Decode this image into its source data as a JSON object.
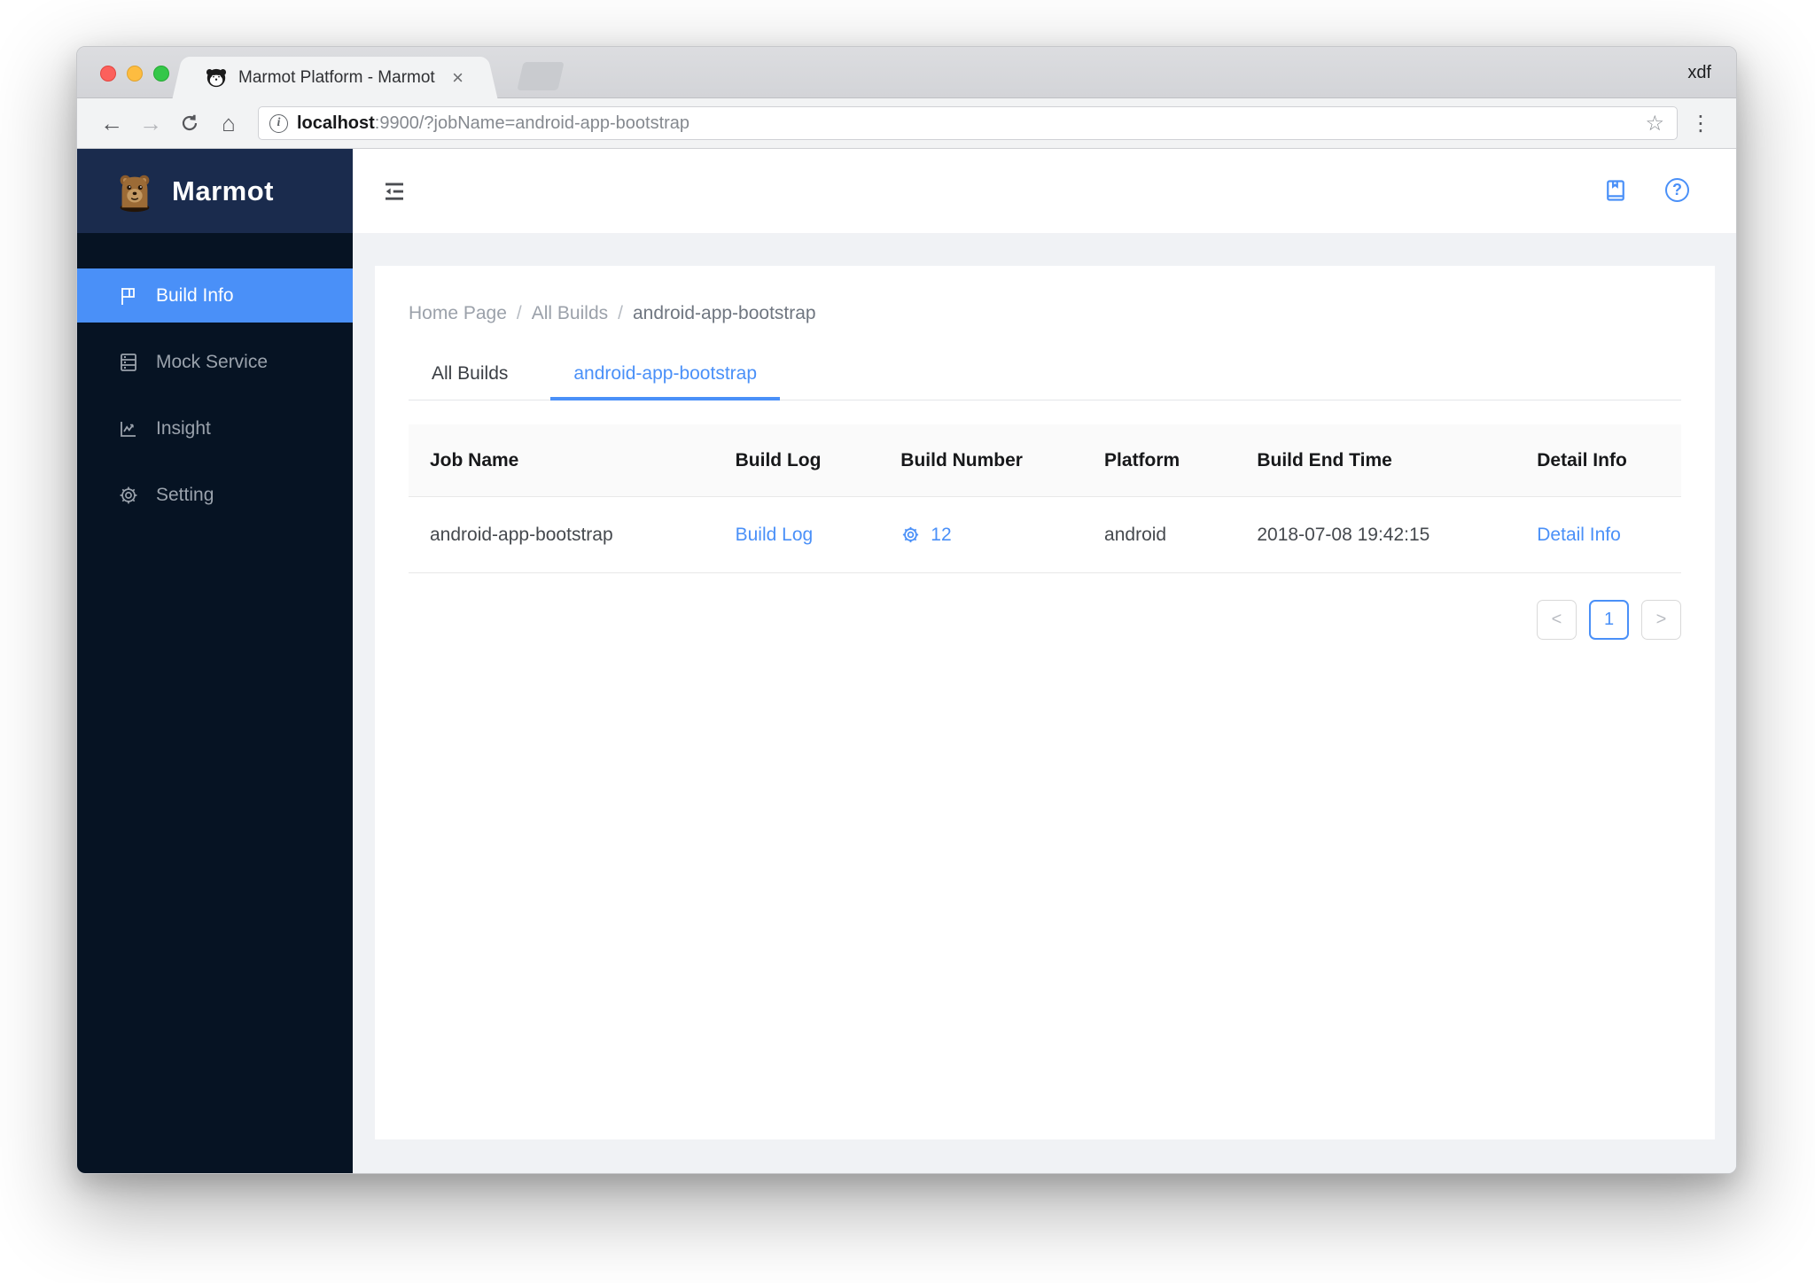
{
  "browser": {
    "profile_name": "xdf",
    "tab_title": "Marmot Platform - Marmot",
    "close_glyph": "×",
    "back_glyph": "←",
    "forward_glyph": "→",
    "home_glyph": "⌂",
    "star_glyph": "☆",
    "menu_glyph": "⋮",
    "info_glyph": "i",
    "url_host": "localhost",
    "url_rest": ":9900/?jobName=android-app-bootstrap"
  },
  "sidebar": {
    "logo_text": "Marmot",
    "items": [
      {
        "label": "Build Info",
        "icon": "flag-icon",
        "active": true
      },
      {
        "label": "Mock Service",
        "icon": "database-icon",
        "active": false
      },
      {
        "label": "Insight",
        "icon": "line-chart-icon",
        "active": false
      },
      {
        "label": "Setting",
        "icon": "gear-icon",
        "active": false
      }
    ]
  },
  "header": {
    "icons": [
      "menu-fold-icon",
      "book-icon",
      "question-circle-icon"
    ],
    "question_glyph": "?"
  },
  "breadcrumb": {
    "separator": "/",
    "items": [
      "Home Page",
      "All Builds",
      "android-app-bootstrap"
    ]
  },
  "tabs": [
    {
      "label": "All Builds",
      "active": false
    },
    {
      "label": "android-app-bootstrap",
      "active": true
    }
  ],
  "table": {
    "columns": [
      "Job Name",
      "Build Log",
      "Build Number",
      "Platform",
      "Build End Time",
      "Detail Info"
    ],
    "rows": [
      {
        "job_name": "android-app-bootstrap",
        "build_log": "Build Log",
        "build_number": "12",
        "platform": "android",
        "build_end_time": "2018-07-08 19:42:15",
        "detail_info": "Detail Info"
      }
    ]
  },
  "pagination": {
    "prev_glyph": "<",
    "current_page": "1",
    "next_glyph": ">"
  },
  "colors": {
    "accent": "#4a90f8",
    "link": "#4a90f8",
    "sidebar_bg": "#061323",
    "sidebar_header_bg": "#1a2b4d",
    "content_bg": "#f0f2f5",
    "table_header_bg": "#fafafa"
  }
}
